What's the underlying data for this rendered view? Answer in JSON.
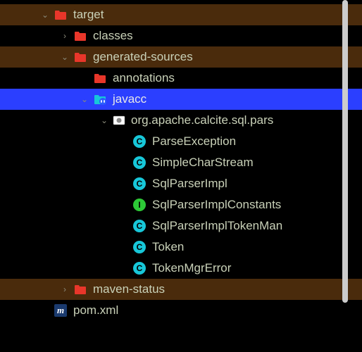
{
  "tree": {
    "items": [
      {
        "depth": 2,
        "expanded": true,
        "icon": "folder-red",
        "label": "target",
        "bg": 1
      },
      {
        "depth": 3,
        "expanded": false,
        "icon": "folder-red",
        "label": "classes",
        "bg": 0
      },
      {
        "depth": 3,
        "expanded": true,
        "icon": "folder-red",
        "label": "generated-sources",
        "bg": 1
      },
      {
        "depth": 4,
        "expanded": null,
        "icon": "folder-red",
        "label": "annotations",
        "bg": 0
      },
      {
        "depth": 4,
        "expanded": true,
        "icon": "folder-blue-source",
        "label": "javacc",
        "selected": true
      },
      {
        "depth": 5,
        "expanded": true,
        "icon": "package",
        "label": "org.apache.calcite.sql.pars",
        "bg": 0
      },
      {
        "depth": 6,
        "expanded": null,
        "icon": "class-c",
        "label": "ParseException",
        "bg": 0
      },
      {
        "depth": 6,
        "expanded": null,
        "icon": "class-c",
        "label": "SimpleCharStream",
        "bg": 0
      },
      {
        "depth": 6,
        "expanded": null,
        "icon": "class-c",
        "label": "SqlParserImpl",
        "bg": 0
      },
      {
        "depth": 6,
        "expanded": null,
        "icon": "class-i",
        "label": "SqlParserImplConstants",
        "bg": 0
      },
      {
        "depth": 6,
        "expanded": null,
        "icon": "class-c",
        "label": "SqlParserImplTokenMan",
        "bg": 0
      },
      {
        "depth": 6,
        "expanded": null,
        "icon": "class-c",
        "label": "Token",
        "bg": 0
      },
      {
        "depth": 6,
        "expanded": null,
        "icon": "class-c",
        "label": "TokenMgrError",
        "bg": 0
      },
      {
        "depth": 3,
        "expanded": false,
        "icon": "folder-red",
        "label": "maven-status",
        "bg": 1
      },
      {
        "depth": 2,
        "expanded": null,
        "icon": "maven",
        "label": "pom.xml",
        "bg": 0
      }
    ]
  },
  "colors": {
    "folder_red": "#e8362a",
    "folder_blue": "#17c7d9",
    "class_c_bg": "#17c7d9",
    "class_i_bg": "#2dc937",
    "selection": "#2b3fff",
    "bg_alt": "#4a2b0c"
  }
}
